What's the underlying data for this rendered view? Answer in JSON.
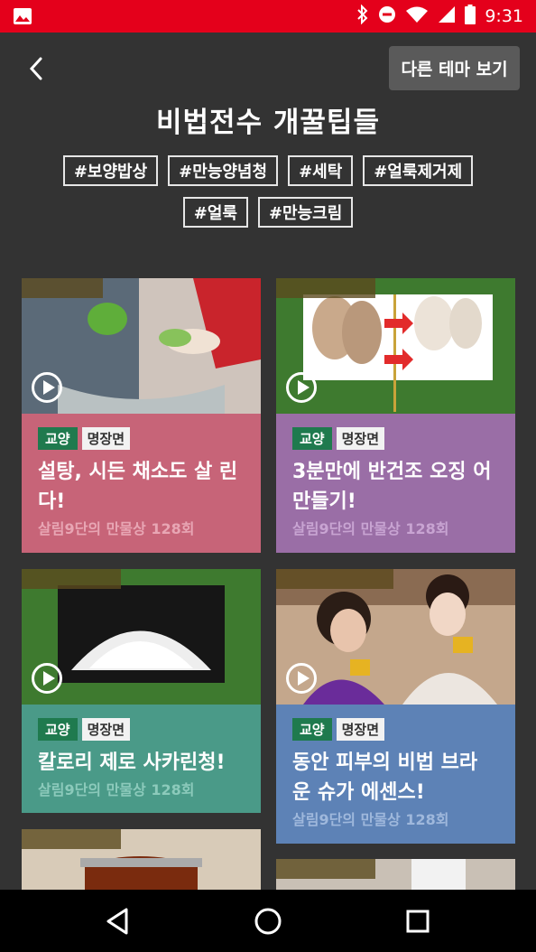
{
  "status_bar": {
    "time": "9:31",
    "bar_color": "#e4001b",
    "icons": [
      "image-icon",
      "bluetooth-icon",
      "do-not-disturb-icon",
      "wifi-icon",
      "cellular-icon",
      "battery-icon"
    ]
  },
  "header": {
    "back_icon": "chevron-left-icon",
    "other_theme_button": "다른 테마 보기",
    "title": "비법전수 개꿀팁들"
  },
  "tags": [
    "#보양밥상",
    "#만능양념청",
    "#세탁",
    "#얼룩제거제",
    "#얼룩",
    "#만능크림"
  ],
  "cards": [
    {
      "badge1": "교양",
      "badge2": "명장면",
      "title": "설탕, 시든 채소도 살 린다!",
      "subtitle": "살림9단의 만물상 128회",
      "color": "#c76478"
    },
    {
      "badge1": "교양",
      "badge2": "명장면",
      "title": "3분만에 반건조 오징 어 만들기!",
      "subtitle": "살림9단의 만물상 128회",
      "color": "#9a6ea6"
    },
    {
      "badge1": "교양",
      "badge2": "명장면",
      "title": "칼로리 제로 사카린청!",
      "subtitle": "살림9단의 만물상 128회",
      "color": "#4a9a88"
    },
    {
      "badge1": "교양",
      "badge2": "명장면",
      "title": "동안 피부의 비법 브라 운 슈가 에센스!",
      "subtitle": "살림9단의 만물상 128회",
      "color": "#5d82b6"
    }
  ],
  "nav_bar": {
    "icons": [
      "back-triangle-icon",
      "home-circle-icon",
      "recents-square-icon"
    ]
  }
}
